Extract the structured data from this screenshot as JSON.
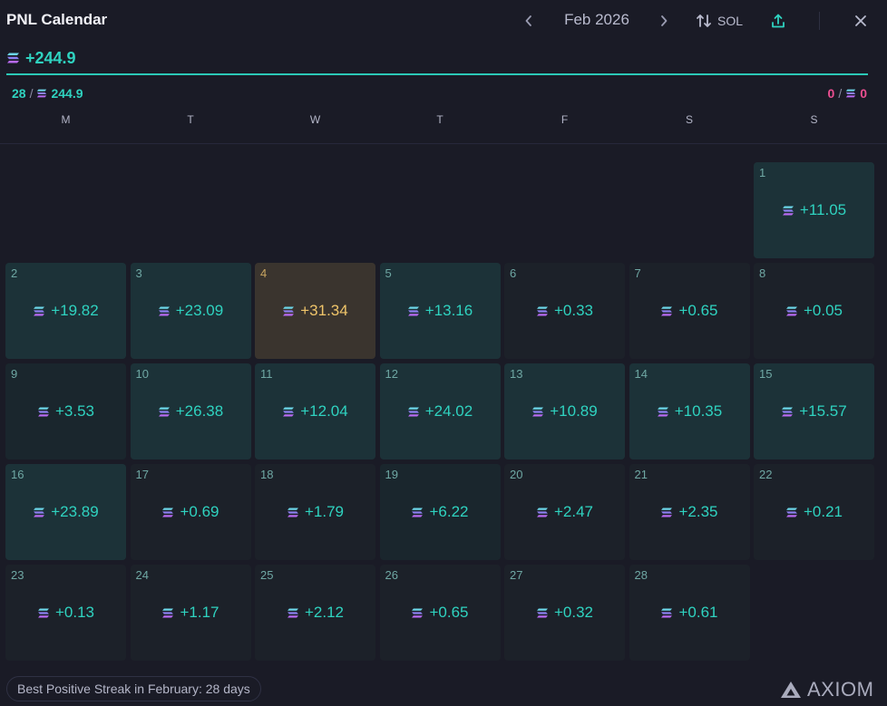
{
  "header": {
    "title": "PNL Calendar",
    "month": "Feb 2026",
    "prev_icon": "chevron-left-icon",
    "next_icon": "chevron-right-icon",
    "currency_label": "SOL",
    "currency_icon": "swap-vertical-icon",
    "share_icon": "share-upload-icon",
    "close_icon": "close-icon"
  },
  "summary": {
    "total": "+244.9",
    "positive_days": "28",
    "positive_sep": "/",
    "positive_total": "244.9",
    "negative_days": "0",
    "negative_sep": "/",
    "negative_total": "0"
  },
  "weekdays": [
    "M",
    "T",
    "W",
    "T",
    "F",
    "S",
    "S"
  ],
  "days": [
    {
      "num": "1",
      "value": "+11.05",
      "tier": "high"
    },
    {
      "num": "2",
      "value": "+19.82",
      "tier": "high"
    },
    {
      "num": "3",
      "value": "+23.09",
      "tier": "high"
    },
    {
      "num": "4",
      "value": "+31.34",
      "tier": "best"
    },
    {
      "num": "5",
      "value": "+13.16",
      "tier": "high"
    },
    {
      "num": "6",
      "value": "+0.33",
      "tier": "low"
    },
    {
      "num": "7",
      "value": "+0.65",
      "tier": "low"
    },
    {
      "num": "8",
      "value": "+0.05",
      "tier": "low"
    },
    {
      "num": "9",
      "value": "+3.53",
      "tier": "mid"
    },
    {
      "num": "10",
      "value": "+26.38",
      "tier": "high"
    },
    {
      "num": "11",
      "value": "+12.04",
      "tier": "high"
    },
    {
      "num": "12",
      "value": "+24.02",
      "tier": "high"
    },
    {
      "num": "13",
      "value": "+10.89",
      "tier": "high"
    },
    {
      "num": "14",
      "value": "+10.35",
      "tier": "high"
    },
    {
      "num": "15",
      "value": "+15.57",
      "tier": "high"
    },
    {
      "num": "16",
      "value": "+23.89",
      "tier": "high"
    },
    {
      "num": "17",
      "value": "+0.69",
      "tier": "low"
    },
    {
      "num": "18",
      "value": "+1.79",
      "tier": "low"
    },
    {
      "num": "19",
      "value": "+6.22",
      "tier": "mid"
    },
    {
      "num": "20",
      "value": "+2.47",
      "tier": "low"
    },
    {
      "num": "21",
      "value": "+2.35",
      "tier": "low"
    },
    {
      "num": "22",
      "value": "+0.21",
      "tier": "low"
    },
    {
      "num": "23",
      "value": "+0.13",
      "tier": "low"
    },
    {
      "num": "24",
      "value": "+1.17",
      "tier": "low"
    },
    {
      "num": "25",
      "value": "+2.12",
      "tier": "low"
    },
    {
      "num": "26",
      "value": "+0.65",
      "tier": "low"
    },
    {
      "num": "27",
      "value": "+0.32",
      "tier": "low"
    },
    {
      "num": "28",
      "value": "+0.61",
      "tier": "low"
    }
  ],
  "colors": {
    "background": "#1a1b26",
    "positive": "#2fd3c0",
    "negative": "#ec4f91",
    "best_day": "#f0c56a",
    "tier_high_bg": "#1c3238",
    "tier_mid_bg": "#1a262d",
    "tier_low_bg": "#1c2129",
    "tier_best_bg": "#3a342e"
  },
  "footer": {
    "streak": "Best Positive Streak in February: 28 days",
    "brand": "AXIOM",
    "brand_icon": "axiom-logo-icon"
  }
}
